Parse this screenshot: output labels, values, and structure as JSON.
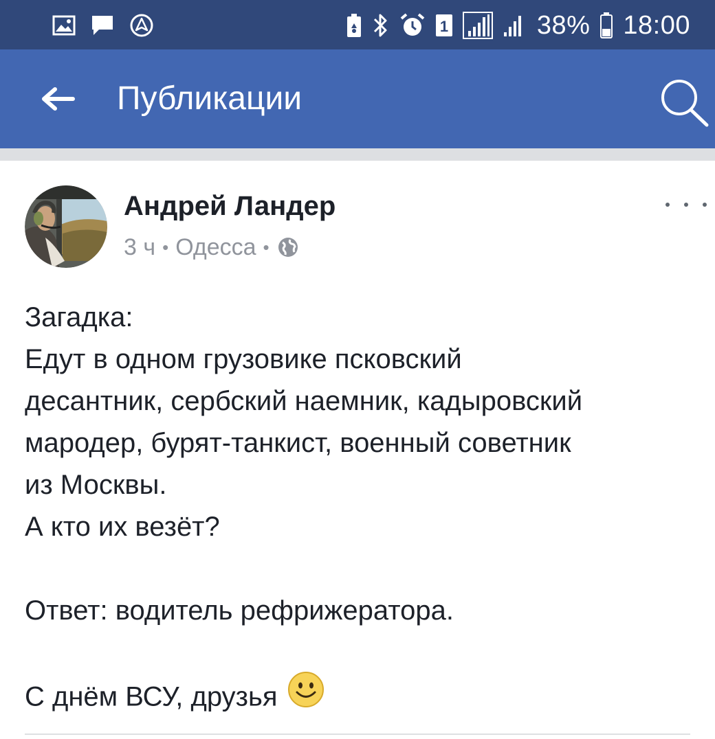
{
  "status_bar": {
    "left_icons": [
      "image-icon",
      "message-icon",
      "navigation-icon"
    ],
    "right_icons": [
      "battery-saver-icon",
      "bluetooth-icon",
      "alarm-icon",
      "sim-1-icon",
      "signal-1-icon",
      "signal-2-icon"
    ],
    "sim_label": "1",
    "battery_percent": "38%",
    "battery_level": 0.38,
    "time": "18:00",
    "background": "#30487a"
  },
  "app_bar": {
    "title": "Публикации",
    "background": "#4267b2"
  },
  "post": {
    "author": "Андрей Ландер",
    "time_ago": "3 ч",
    "location": "Одесса",
    "separator": "•",
    "privacy_icon": "globe-icon",
    "body_lines": [
      "Загадка:",
      "Едут в одном грузовике псковский",
      "десантник, сербский наемник, кадыровский",
      "мародер, бурят-танкист, военный советник",
      "из Москвы.",
      "А кто их везёт?",
      "",
      "Ответ: водитель рефрижератора.",
      "",
      "С днём ВСУ, друзья"
    ],
    "emoji": "smiley-emoji-icon"
  },
  "colors": {
    "name_text": "#1d2129",
    "meta_text": "#90949c",
    "divider": "#dddfe2"
  }
}
